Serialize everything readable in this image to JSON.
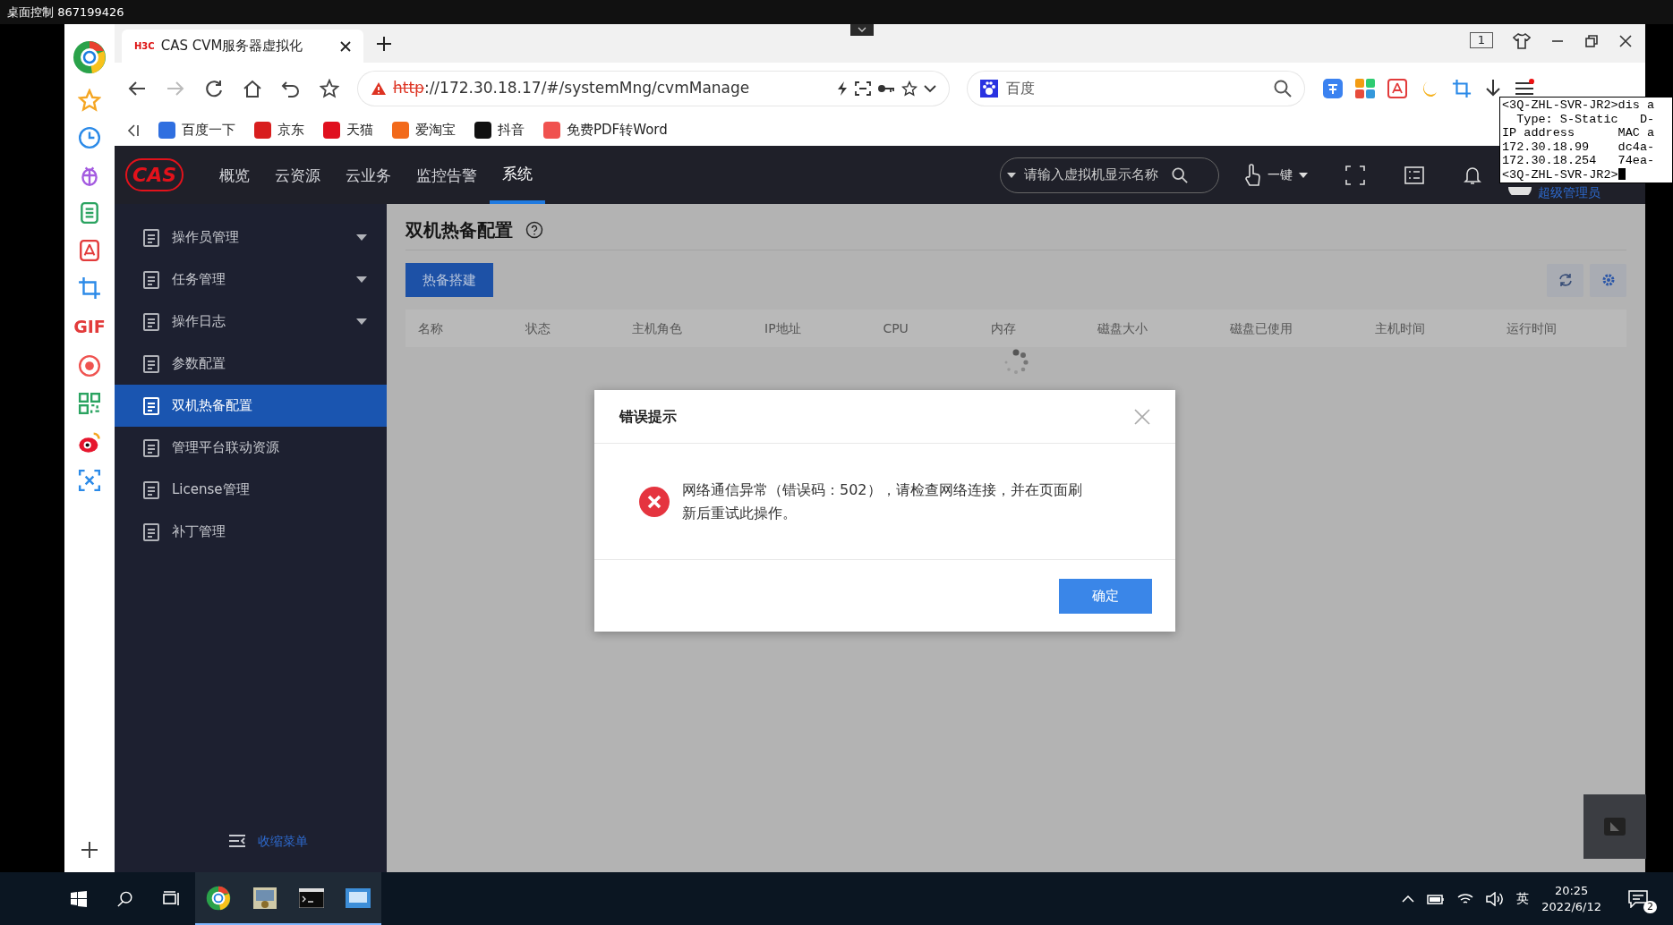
{
  "remote_window": {
    "title": "桌面控制 867199426"
  },
  "browser": {
    "gif_label": "GIF",
    "tabs": [
      {
        "title": "CAS CVM服务器虚拟化",
        "logo": "H3C",
        "selected": true
      }
    ],
    "tab_counter": "1",
    "address": {
      "scheme": "http",
      "rest": "://172.30.18.17/#/systemMng/cvmManage",
      "insecure": true
    },
    "search": {
      "placeholder": "百度"
    },
    "bookmarks": [
      {
        "label": "百度一下",
        "color": "#2f6fe0"
      },
      {
        "label": "京东",
        "color": "#d81e1e"
      },
      {
        "label": "天猫",
        "color": "#e0101e"
      },
      {
        "label": "爱淘宝",
        "color": "#f26a1b"
      },
      {
        "label": "抖音",
        "color": "#111111"
      },
      {
        "label": "免费PDF转Word",
        "color": "#f0524f"
      }
    ]
  },
  "app": {
    "logo": "CAS",
    "nav": [
      {
        "label": "概览",
        "selected": false
      },
      {
        "label": "云资源",
        "selected": false
      },
      {
        "label": "云业务",
        "selected": false
      },
      {
        "label": "监控告警",
        "selected": false
      },
      {
        "label": "系统",
        "selected": true
      }
    ],
    "search": {
      "placeholder": "请输入虚拟机显示名称"
    },
    "one_key": "一键",
    "user": "超级管理员",
    "sidebar": [
      {
        "label": "操作员管理",
        "expandable": true,
        "selected": false
      },
      {
        "label": "任务管理",
        "expandable": true,
        "selected": false
      },
      {
        "label": "操作日志",
        "expandable": true,
        "selected": false
      },
      {
        "label": "参数配置",
        "expandable": false,
        "selected": false
      },
      {
        "label": "双机热备配置",
        "expandable": false,
        "selected": true
      },
      {
        "label": "管理平台联动资源",
        "expandable": false,
        "selected": false
      },
      {
        "label": "License管理",
        "expandable": false,
        "selected": false
      },
      {
        "label": "补丁管理",
        "expandable": false,
        "selected": false
      }
    ],
    "collapse_menu": "收缩菜单",
    "page_title": "双机热备配置",
    "primary_button": "热备搭建",
    "columns": [
      "名称",
      "状态",
      "主机角色",
      "IP地址",
      "CPU",
      "内存",
      "磁盘大小",
      "磁盘已使用",
      "主机时间",
      "运行时间"
    ]
  },
  "dialog": {
    "title": "错误提示",
    "message": "网络通信异常（错误码：502），请检查网络连接，并在页面刷新后重试此操作。",
    "ok": "确定"
  },
  "terminal": {
    "lines": [
      "<3Q-ZHL-SVR-JR2>dis a",
      "  Type: S-Static   D-",
      "IP address      MAC a",
      "172.30.18.99    dc4a-",
      "172.30.18.254   74ea-",
      "<3Q-ZHL-SVR-JR2>"
    ]
  },
  "taskbar": {
    "ime": "英",
    "time": "20:25",
    "date": "2022/6/12",
    "notifications": "2"
  }
}
